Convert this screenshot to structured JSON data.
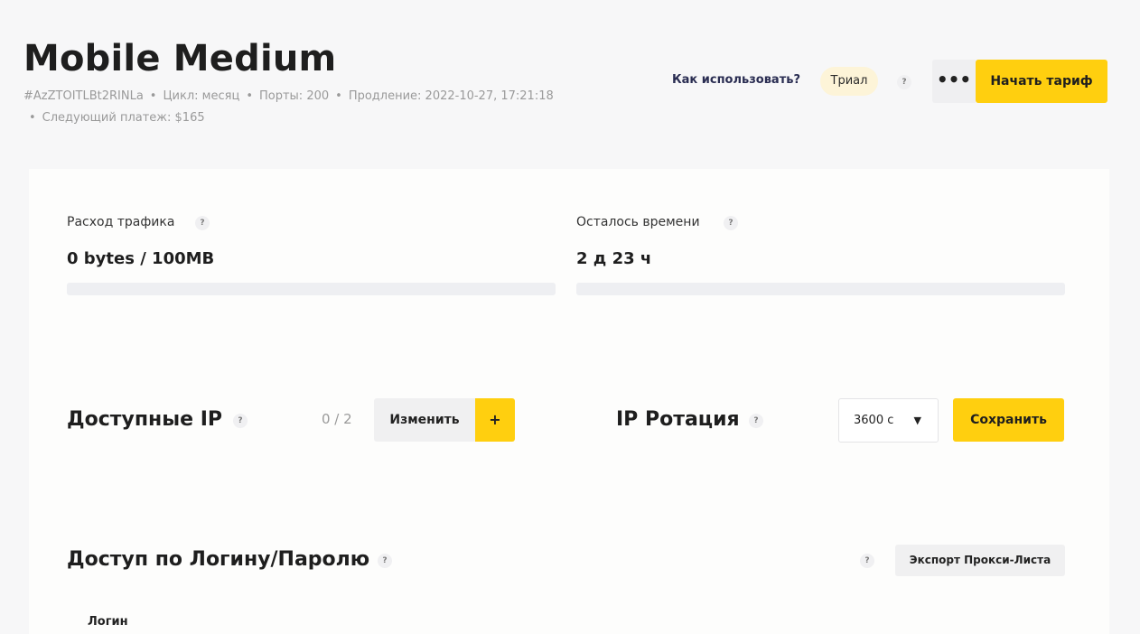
{
  "header": {
    "title": "Mobile Medium",
    "id": "#AzZTOITLBt2RINLa",
    "cycle": "Цикл: месяц",
    "ports": "Порты: 200",
    "renewal": "Продление: 2022-10-27, 17:21:18",
    "next_payment": "Следующий платеж: $165",
    "how_to_use": "Как использовать?",
    "trial_badge": "Триал",
    "help_mark": "?",
    "more_label": "•••",
    "start_button": "Начать тариф"
  },
  "stats": {
    "traffic": {
      "label": "Расход трафика",
      "value": "0 bytes / 100MB",
      "progress": 0
    },
    "time_left": {
      "label": "Осталось времени",
      "value": "2 д 23 ч",
      "progress": 0
    }
  },
  "available_ip": {
    "title": "Доступные IP",
    "count": "0 / 2",
    "change_button": "Изменить",
    "add_button": "+"
  },
  "rotation": {
    "title": "IP Ротация",
    "selected_interval": "3600 с",
    "caret": "▼",
    "save_button": "Сохранить"
  },
  "access": {
    "title": "Доступ по Логину/Паролю",
    "export_button": "Экспорт Прокси-Листа",
    "column_login": "Логин"
  },
  "colors": {
    "accent": "#ffcf0f",
    "link": "#2a2d52",
    "trial_bg": "#fdf4d8"
  }
}
